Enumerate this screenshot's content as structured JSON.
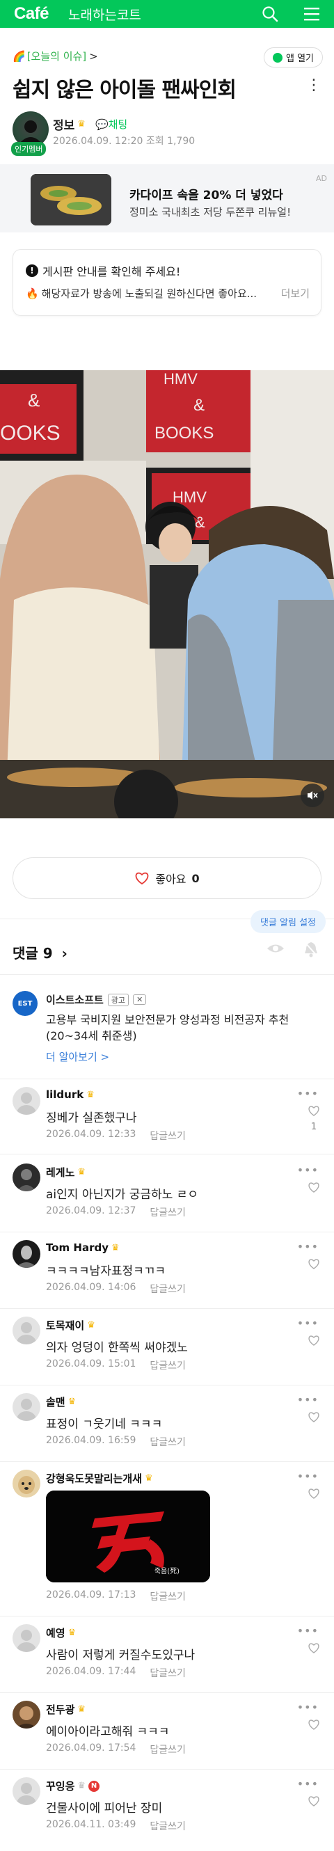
{
  "header": {
    "logo": "Café",
    "cafe_name": "노래하는코트",
    "icons": [
      "search-icon",
      "menu-icon"
    ],
    "brand_color": "#03c75a"
  },
  "post": {
    "issue_label": "[오늘의 이슈]",
    "issue_arrow": ">",
    "app_open": "앱 열기",
    "title": "쉽지 않은 아이돌 팬싸인회",
    "author": "정보",
    "author_badge": "인기멤버",
    "chat_label": "채팅",
    "meta": "2026.04.09. 12:20  조회 1,790"
  },
  "ad": {
    "tag": "AD",
    "title": "카다이프 속을 20% 더 넣었다",
    "subtitle": "정미소 국내최초 저당 두쫀쿠 리뉴얼!"
  },
  "notice": {
    "line1": "게시판 안내를 확인해 주세요!",
    "line2": "해당자료가 방송에 노출되길 원하신다면 좋아요...",
    "more": "더보기"
  },
  "like": {
    "label": "좋아요",
    "count": "0"
  },
  "comments": {
    "alarm_setting": "댓글 알림 설정",
    "header": "댓글 9",
    "ad_comment": {
      "logo_text": "EST",
      "name": "이스트소프트",
      "badge": "광고",
      "close": "✕",
      "body": "고용부 국비지원 보안전문가 양성과정 비전공자 추천 (20~34세 취준생)",
      "link": "더 알아보기 >"
    },
    "reply_label": "답글쓰기",
    "items": [
      {
        "name": "lildurk",
        "text": "징베가 실존했구나",
        "date": "2026.04.09. 12:33",
        "likes": "1"
      },
      {
        "name": "레게노",
        "text": "ai인지 아닌지가 궁금하노 ㄹㅇ",
        "date": "2026.04.09. 12:37",
        "likes": ""
      },
      {
        "name": "Tom Hardy",
        "text": "ㅋㅋㅋㅋ남자표정ㅋㄲㅋ",
        "date": "2026.04.09. 14:06",
        "likes": ""
      },
      {
        "name": "토목재이",
        "text": "의자 엉덩이 한쪽씩 써야겠노",
        "date": "2026.04.09. 15:01",
        "likes": ""
      },
      {
        "name": "솔맨",
        "text": "표정이 ㄱ웃기네 ㅋㅋㅋ",
        "date": "2026.04.09. 16:59",
        "likes": ""
      },
      {
        "name": "강형욱도못말리는개새",
        "text": "",
        "sticker_caption": "죽음(死)",
        "date": "2026.04.09. 17:13",
        "likes": ""
      },
      {
        "name": "예영",
        "text": "사람이 저렇게 커질수도있구나",
        "date": "2026.04.09. 17:44",
        "likes": ""
      },
      {
        "name": "전두광",
        "text": "에이아이라고해줘 ㅋㅋㅋ",
        "date": "2026.04.09. 17:54",
        "likes": ""
      },
      {
        "name": "꾸잉응",
        "badge": "N",
        "text": "건물사이에 피어난 장미",
        "date": "2026.04.11. 03:49",
        "likes": ""
      }
    ]
  },
  "photo": {
    "signs": [
      "HMV",
      "&",
      "BOOKS"
    ],
    "left_sign": [
      "&",
      "OOKS"
    ]
  }
}
